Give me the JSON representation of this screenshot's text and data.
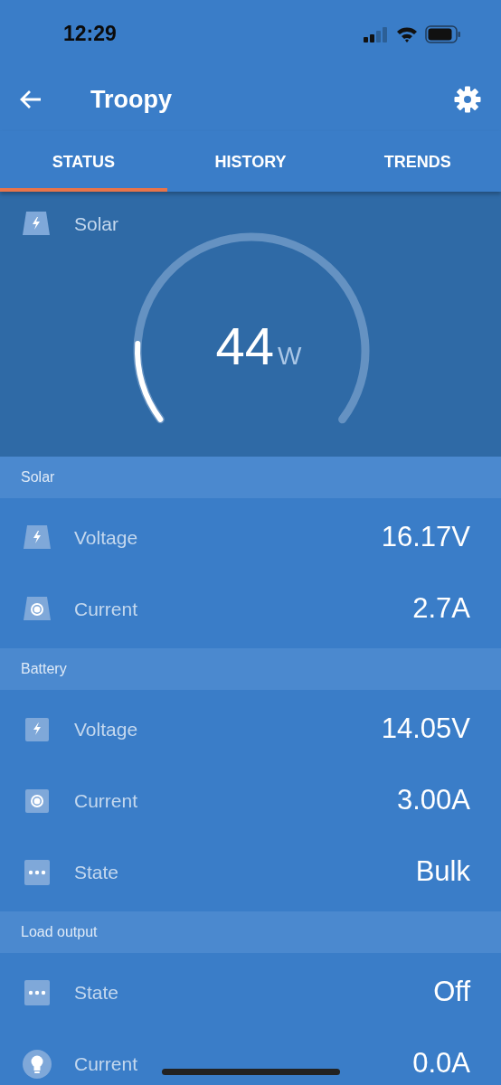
{
  "status_bar": {
    "time": "12:29"
  },
  "app_bar": {
    "title": "Troopy"
  },
  "tabs": [
    {
      "label": "STATUS",
      "selected": true
    },
    {
      "label": "HISTORY",
      "selected": false
    },
    {
      "label": "TRENDS",
      "selected": false
    }
  ],
  "gauge": {
    "label": "Solar",
    "value": "44",
    "unit": "W"
  },
  "sections": [
    {
      "title": "Solar",
      "rows": [
        {
          "kind": "panel-bolt",
          "label": "Voltage",
          "value": "16.17V"
        },
        {
          "kind": "panel-dot",
          "label": "Current",
          "value": "2.7A"
        }
      ]
    },
    {
      "title": "Battery",
      "rows": [
        {
          "kind": "battery-bolt",
          "label": "Voltage",
          "value": "14.05V"
        },
        {
          "kind": "battery-dot",
          "label": "Current",
          "value": "3.00A"
        },
        {
          "kind": "dots",
          "label": "State",
          "value": "Bulk"
        }
      ]
    },
    {
      "title": "Load output",
      "rows": [
        {
          "kind": "dots",
          "label": "State",
          "value": "Off"
        },
        {
          "kind": "bulb",
          "label": "Current",
          "value": "0.0A"
        }
      ]
    }
  ]
}
